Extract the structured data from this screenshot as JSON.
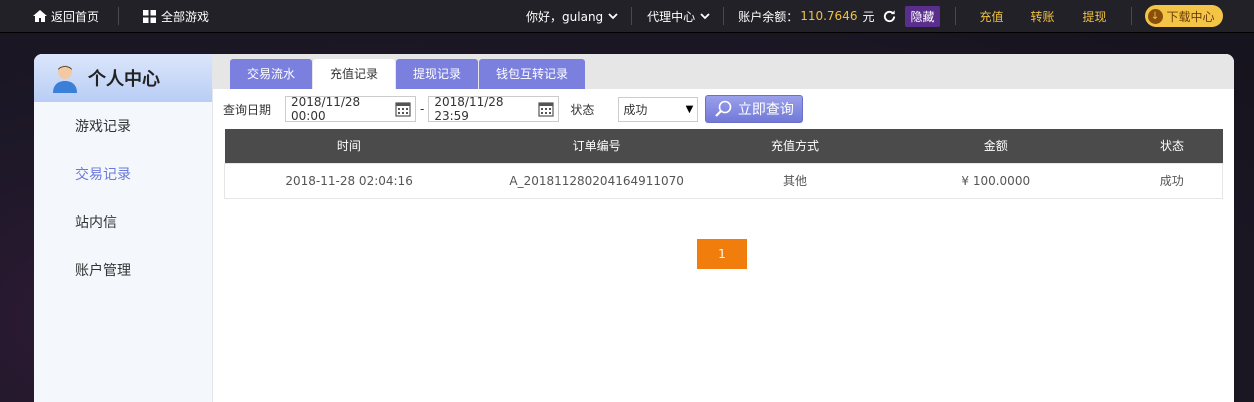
{
  "topbar": {
    "home": "返回首页",
    "all_games": "全部游戏",
    "greeting": "你好，gulang",
    "agent": "代理中心",
    "balance_label": "账户余额：",
    "balance_value": "110.7646",
    "balance_unit": "元",
    "hide": "隐藏",
    "recharge": "充值",
    "transfer": "转账",
    "withdraw": "提现",
    "download": "下载中心"
  },
  "sidebar": {
    "title": "个人中心",
    "items": [
      {
        "label": "游戏记录"
      },
      {
        "label": "交易记录"
      },
      {
        "label": "站内信"
      },
      {
        "label": "账户管理"
      }
    ]
  },
  "tabs": [
    {
      "label": "交易流水"
    },
    {
      "label": "充值记录"
    },
    {
      "label": "提现记录"
    },
    {
      "label": "钱包互转记录"
    }
  ],
  "filter": {
    "date_label": "查询日期",
    "start": "2018/11/28 00:00",
    "dash": "-",
    "end": "2018/11/28 23:59",
    "status_label": "状态",
    "status_value": "成功",
    "query_button": "立即查询"
  },
  "table": {
    "headers": [
      "时间",
      "订单编号",
      "充值方式",
      "金额",
      "状态"
    ],
    "rows": [
      [
        "2018-11-28 02:04:16",
        "A_201811280204164911070",
        "其他",
        "¥ 100.0000",
        "成功"
      ]
    ]
  },
  "pagination": {
    "current": "1"
  },
  "colors": {
    "accent": "#7b80de",
    "pager": "#f17d0d",
    "balance": "#f0c040"
  }
}
